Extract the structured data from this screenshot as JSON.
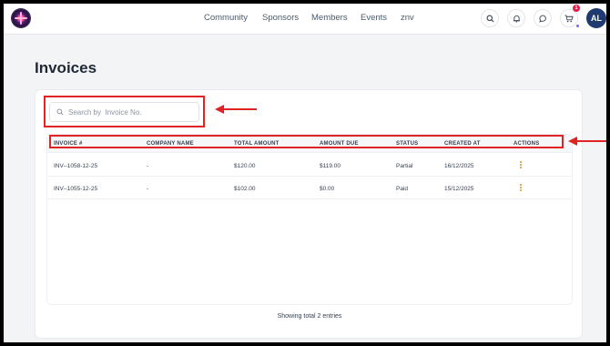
{
  "nav": {
    "items": [
      "Community",
      "Sponsors",
      "Members",
      "Events",
      "znv"
    ]
  },
  "header": {
    "cart_badge": "1",
    "avatar_initials": "AL",
    "icons": [
      "search-icon",
      "bell-icon",
      "chat-icon",
      "cart-icon"
    ]
  },
  "page": {
    "title": "Invoices"
  },
  "search": {
    "placeholder": "Search by  Invoice No.",
    "value": ""
  },
  "table": {
    "columns": [
      "INVOICE #",
      "COMPANY NAME",
      "TOTAL AMOUNT",
      "AMOUNT DUE",
      "STATUS",
      "CREATED AT",
      "ACTIONS"
    ],
    "rows": [
      [
        "INV--1058-12-25",
        "-",
        "$120.00",
        "$119.00",
        "Partial",
        "16/12/2025"
      ],
      [
        "INV--1055-12-25",
        "-",
        "$102.00",
        "$0.00",
        "Paid",
        "15/12/2025"
      ]
    ]
  },
  "footer": {
    "summary": "Showing total 2 entries"
  },
  "colors": {
    "annotation": "#e02424",
    "avatar": "#1e3a6e",
    "badge": "#e11d48",
    "action_dots": "#d29922"
  }
}
